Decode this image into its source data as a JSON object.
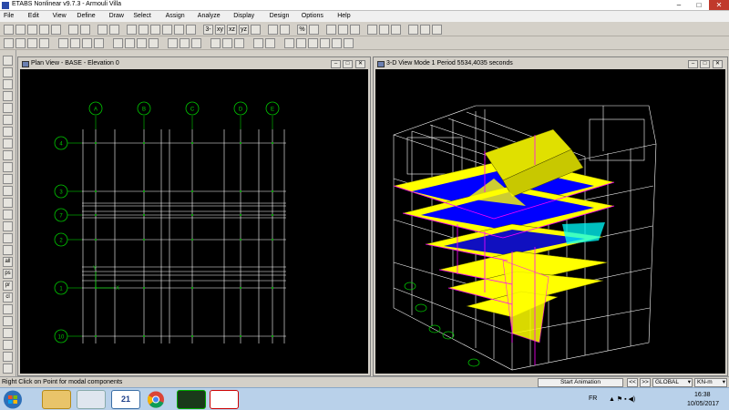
{
  "app": {
    "title": "ETABS Nonlinear v9.7.3 - Armouli  Villa",
    "min": "–",
    "max": "□",
    "close": "✕"
  },
  "menu": [
    "File",
    "Edit",
    "View",
    "Define",
    "Draw",
    "Select",
    "Assign",
    "Analyze",
    "Display",
    "Design",
    "Options",
    "Help"
  ],
  "toolbar": {
    "row1": [
      "new-icon",
      "open-icon",
      "save-icon",
      "print-icon",
      "print-preview-icon",
      "undo-icon",
      "redo-icon",
      "lock-icon",
      "refresh-icon",
      "pan-icon",
      "zoom-window-icon",
      "zoom-in-icon",
      "zoom-out-icon",
      "zoom-all-icon",
      "zoom-previous-icon",
      "3d-view-icon",
      "plan-view-icon",
      "elevation-view-icon",
      "rotate-icon",
      "perspective-icon",
      "up-icon",
      "down-icon",
      "object-shrink-icon",
      "set-display-icon",
      "run-analysis-icon",
      "lock-model-icon",
      "display-undeformed-icon",
      "display-loads-icon",
      "display-deformed-icon",
      "display-mode-icon",
      "member-forces-icon",
      "design-icon",
      "display-table-icon"
    ],
    "row1_text": {
      "three_d": "3-d",
      "xy": "xy",
      "xz": "xz",
      "yz": "yz",
      "percent": "%"
    },
    "row2": [
      "select-icon",
      "reshape-icon",
      "point-icon",
      "line-icon",
      "area-icon",
      "section-icon",
      "wall-icon",
      "draw-grid-icon",
      "beam-icon",
      "column-icon",
      "brace-icon",
      "floor-icon",
      "opening-icon",
      "link-icon",
      "frame-release-icon",
      "restraint-icon",
      "diaphragm-icon",
      "load-icon",
      "snap-icon",
      "snap-mid-icon",
      "snap-end-icon",
      "snap-intersection-icon",
      "snap-perpendicular-icon",
      "snap-line-icon",
      "snap-grid-icon",
      "snap-off-icon"
    ]
  },
  "left_toolbar": [
    "pointer-icon",
    "reshape-icon",
    "draw-point-icon",
    "draw-line-icon",
    "draw-beam-icon",
    "draw-column-icon",
    "draw-brace-icon",
    "draw-area-icon",
    "draw-wall-icon",
    "draw-opening-icon",
    "draw-rect-icon",
    "draw-poly-icon",
    "draw-grid-icon",
    "select-all-icon",
    "restore-icon",
    "clear-icon",
    "pattern-icon",
    "all-icon",
    "ps-icon",
    "pr-icon",
    "cl-icon",
    "link-icon",
    "intersect-icon",
    "snap-icon",
    "snap-mid-icon",
    "snap-end-icon",
    "snap-perp-icon"
  ],
  "left_toolbar_text": {
    "all": "all",
    "ps": "ps",
    "pr": "pr",
    "cl": "cl"
  },
  "plan_window": {
    "title": "Plan View - BASE - Elevation 0",
    "grid_x_labels": [
      "A",
      "B",
      "C",
      "D",
      "E"
    ],
    "grid_y_labels": [
      "4",
      "3",
      "7",
      "2",
      "1",
      "10"
    ],
    "axis_labels": {
      "x": "X",
      "y": "Y"
    }
  },
  "view3d_window": {
    "title": "3-D View  Mode 1  Period 5534,4035 seconds"
  },
  "status": {
    "message": "Right Click on Point for modal components",
    "start_animation": "Start Animation",
    "prev": "<<",
    "next": ">>",
    "coord_system": "GLOBAL",
    "units": "KN-m",
    "dropdown_arrow": "▾"
  },
  "taskbar": {
    "apps": [
      "windows-start-icon",
      "explorer-icon",
      "etabs-doc-icon",
      "calendar-icon",
      "chrome-icon",
      "etabs-icon",
      "autocad-icon"
    ],
    "calendar_badge": "21",
    "lang": "FR",
    "tray_icons": "▲ ⚑ ▪ ◀)",
    "time": "16:38",
    "date": "10/05/2017"
  },
  "colors": {
    "grid": "#ffffff",
    "grid_dot": "#00c800",
    "slab": "#ffff00",
    "slab_core": "#0000ff",
    "shell_edge": "#ff00ff",
    "cyan": "#00ffff",
    "bg": "#000000"
  }
}
